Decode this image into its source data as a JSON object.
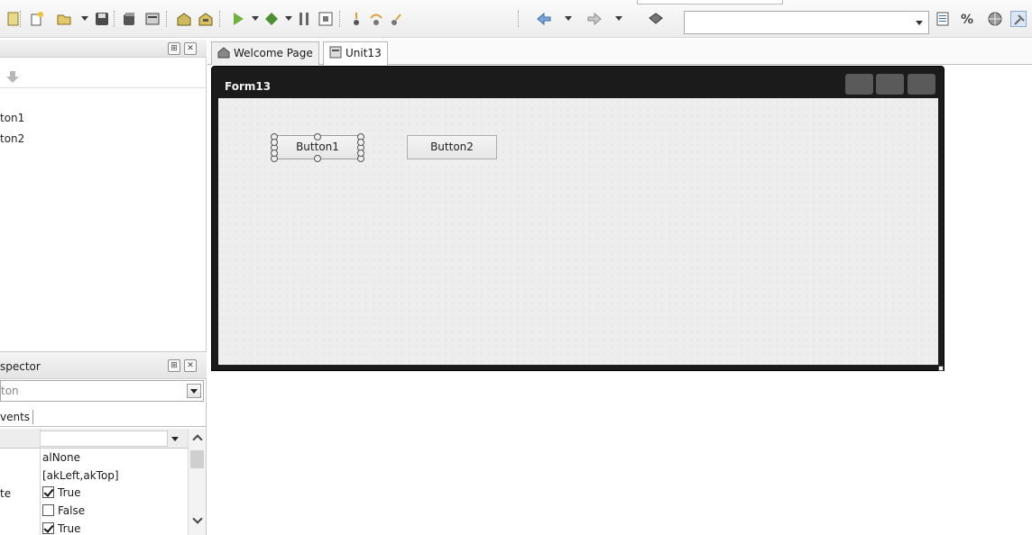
{
  "tree": {
    "items": [
      "ton1",
      "ton2"
    ]
  },
  "inspector": {
    "title": "spector",
    "selected_component": "ton",
    "tab_label": "vents",
    "properties": [
      {
        "name": "",
        "value": "alNone",
        "kind": "text"
      },
      {
        "name": "",
        "value": "[akLeft,akTop]",
        "kind": "text"
      },
      {
        "name": "te",
        "value": "True",
        "kind": "checkbox",
        "checked": true
      },
      {
        "name": "",
        "value": "False",
        "kind": "checkbox",
        "checked": false
      },
      {
        "name": "",
        "value": "True",
        "kind": "checkbox",
        "checked": true
      }
    ]
  },
  "editor": {
    "tabs": [
      {
        "label": "Welcome Page",
        "active": false
      },
      {
        "label": "Unit13",
        "active": true
      }
    ]
  },
  "form": {
    "caption": "Form13",
    "button1_caption": "Button1",
    "button2_caption": "Button2"
  },
  "icons": {
    "toolbar": [
      "new-unit-icon",
      "open-icon",
      "save-icon",
      "save-all-icon",
      "close-icon",
      "add-icon",
      "remove-icon",
      "run-icon",
      "debug-icon",
      "pause-icon",
      "stop-icon",
      "step-into-icon",
      "step-over-icon",
      "step-out-icon",
      "back-icon",
      "forward-icon",
      "book-icon",
      "page-icon",
      "percent-icon",
      "globe-icon",
      "tools-icon"
    ],
    "pane": [
      "pin-icon",
      "close-icon"
    ]
  },
  "colors": {
    "form_title_bar": "#1b1b1b",
    "form_client": "#eeeeee",
    "caption_button": "#5a5a5a"
  }
}
